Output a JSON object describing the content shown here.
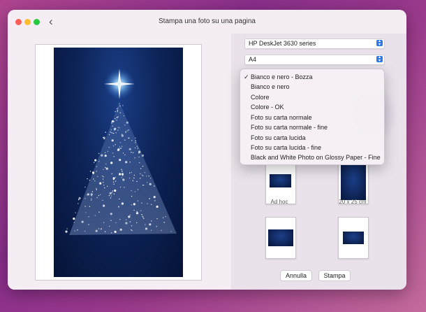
{
  "window": {
    "title": "Stampa una foto su una pagina",
    "back_label": "‹"
  },
  "printer": {
    "printer_value": "HP DeskJet 3630 series",
    "paper_value": "A4"
  },
  "dropdown": {
    "items": [
      {
        "label": "Bianco e nero - Bozza",
        "checked": true
      },
      {
        "label": "Bianco e nero",
        "checked": false
      },
      {
        "label": "Colore",
        "checked": false
      },
      {
        "label": "Colore - OK",
        "checked": false
      },
      {
        "label": "Foto su carta normale",
        "checked": false
      },
      {
        "label": "Foto su carta normale - fine",
        "checked": false
      },
      {
        "label": "Foto su carta lucida",
        "checked": false
      },
      {
        "label": "Foto su carta lucida - fine",
        "checked": false
      },
      {
        "label": "Black and White Photo on Glossy Paper - Fine",
        "checked": false
      }
    ],
    "check_glyph": "✓"
  },
  "layouts": {
    "adhoc_label": "Ad hoc",
    "size_label": "20 x 25 cm"
  },
  "buttons": {
    "cancel": "Annulla",
    "print": "Stampa"
  },
  "colors": {
    "accent": "#2f7ae5",
    "photo_bg": "#0d2458",
    "star": "#ffffff"
  }
}
